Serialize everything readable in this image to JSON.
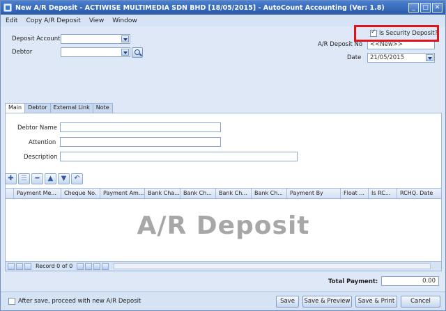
{
  "window": {
    "title": "New A/R Deposit - ACTIWISE MULTIMEDIA SDN BHD [18/05/2015] - AutoCount Accounting (Ver: 1.8)",
    "buttons": {
      "minimize": "_",
      "maximize": "□",
      "close": "✕"
    }
  },
  "menu": [
    "Edit",
    "Copy A/R Deposit",
    "View",
    "Window"
  ],
  "header": {
    "deposit_account_label": "Deposit Account",
    "deposit_account_value": "",
    "debtor_label": "Debtor",
    "debtor_value": "",
    "security_deposit_label": "Is Security Deposit?",
    "security_deposit_checked": true,
    "deposit_no_label": "A/R Deposit No",
    "deposit_no_value": "<<New>>",
    "date_label": "Date",
    "date_value": "21/05/2015"
  },
  "tabs": [
    "Main",
    "Debtor",
    "External Link",
    "Note"
  ],
  "main": {
    "debtor_name_label": "Debtor Name",
    "attention_label": "Attention",
    "description_label": "Description"
  },
  "toolbar_icons": [
    "add-icon",
    "insert-icon",
    "remove-icon",
    "move-up-icon",
    "move-down-icon",
    "undo-icon"
  ],
  "grid": {
    "columns": [
      "Payment Me...",
      "Cheque No.",
      "Payment Am...",
      "Bank Cha...",
      "Bank Ch...",
      "Bank Ch...",
      "Bank Ch...",
      "Payment By",
      "Float ...",
      "Is RC...",
      "RCHQ. Date"
    ],
    "watermark": "A/R Deposit",
    "record_text": "Record 0 of 0"
  },
  "totals": {
    "label": "Total Payment:",
    "value": "0.00"
  },
  "footer": {
    "proceed_label": "After save, proceed with new A/R Deposit",
    "save": "Save",
    "save_preview": "Save & Preview",
    "save_print": "Save & Print",
    "cancel": "Cancel"
  }
}
